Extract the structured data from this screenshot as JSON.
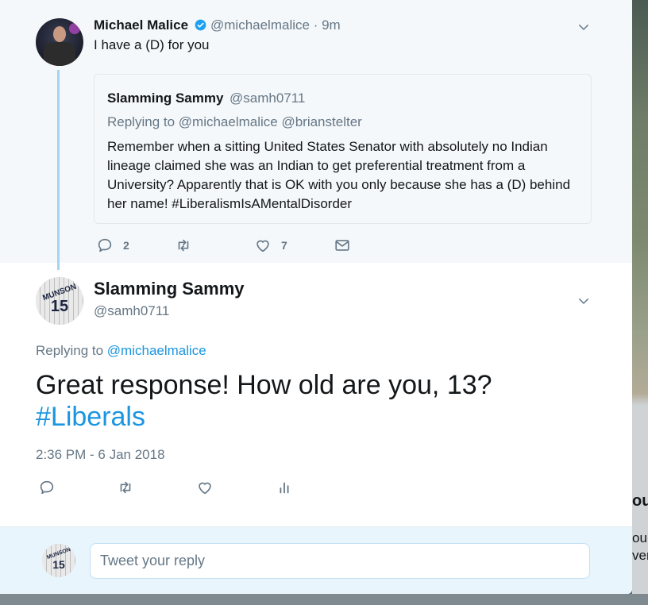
{
  "ancestor_tweet": {
    "author_name": "Michael Malice",
    "author_handle": "@michaelmalice",
    "time_ago": "· 9m",
    "text": "I have a (D) for you",
    "quoted": {
      "author_name": "Slamming Sammy",
      "author_handle": "@samh0711",
      "replying_to": "Replying to @michaelmalice @brianstelter",
      "text": "Remember when a sitting United States Senator with absolutely no Indian lineage claimed she was an Indian to get preferential treatment from a University? Apparently that is OK with you only because she has a (D) behind her name! #LiberalismIsAMentalDisorder"
    },
    "reply_count": "2",
    "retweet_count": "",
    "like_count": "7"
  },
  "main_tweet": {
    "author_name": "Slamming Sammy",
    "author_handle": "@samh0711",
    "replying_prefix": "Replying to",
    "replying_handle": "@michaelmalice",
    "text_main": "Great response! How old are you, 13?",
    "hashtag": "#Liberals",
    "timestamp": "2:36 PM - 6 Jan 2018"
  },
  "avatars": {
    "jersey_name": "MUNSON",
    "jersey_number": "15"
  },
  "reply_box": {
    "placeholder": "Tweet your reply"
  },
  "background_fragments": [
    "ou",
    "our",
    "ver"
  ],
  "colors": {
    "accent": "#1b95e0",
    "muted": "#657786",
    "thread_line": "#a7d4f0"
  }
}
